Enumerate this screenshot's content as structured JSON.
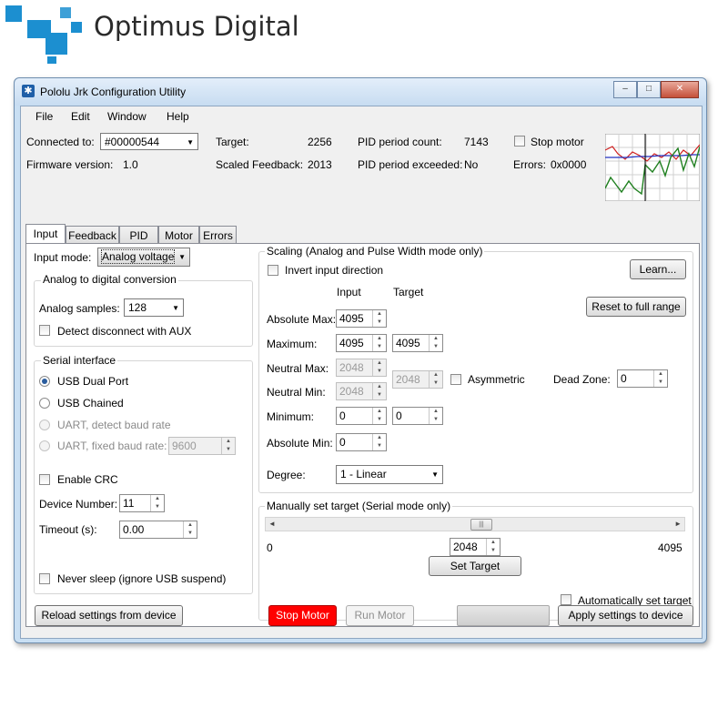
{
  "brand": {
    "name": "Optimus Digital"
  },
  "window": {
    "title": "Pololu Jrk Configuration Utility",
    "minimize": "–",
    "maximize": "□",
    "close": "✕"
  },
  "menu": [
    "File",
    "Edit",
    "Window",
    "Help"
  ],
  "status": {
    "connected_label": "Connected to:",
    "device": "#00000544",
    "firmware_label": "Firmware version:",
    "firmware": "1.0",
    "target_label": "Target:",
    "target": "2256",
    "scaled_feedback_label": "Scaled Feedback:",
    "scaled_feedback": "2013",
    "pid_count_label": "PID period count:",
    "pid_count": "7143",
    "pid_exceeded_label": "PID period exceeded:",
    "pid_exceeded": "No",
    "stop_motor_label": "Stop motor",
    "errors_label": "Errors:",
    "errors": "0x0000"
  },
  "tabs": [
    "Input",
    "Feedback",
    "PID",
    "Motor",
    "Errors"
  ],
  "input": {
    "mode_label": "Input mode:",
    "mode": "Analog voltage",
    "adc_group": "Analog to digital conversion",
    "samples_label": "Analog samples:",
    "samples": "128",
    "detect_disconnect": "Detect disconnect with AUX",
    "serial_group": "Serial interface",
    "serial_options": [
      "USB Dual Port",
      "USB Chained",
      "UART, detect baud rate",
      "UART, fixed baud rate:"
    ],
    "baud": "9600",
    "enable_crc": "Enable CRC",
    "device_number_label": "Device Number:",
    "device_number": "11",
    "timeout_label": "Timeout (s):",
    "timeout": "0.00",
    "never_sleep": "Never sleep (ignore USB suspend)"
  },
  "scaling": {
    "group": "Scaling (Analog and Pulse Width mode only)",
    "invert": "Invert input direction",
    "learn": "Learn...",
    "reset": "Reset to full range",
    "col_input": "Input",
    "col_target": "Target",
    "abs_max_label": "Absolute Max:",
    "abs_max": "4095",
    "max_label": "Maximum:",
    "max_input": "4095",
    "max_target": "4095",
    "neutral_max_label": "Neutral Max:",
    "neutral_max": "2048",
    "neutral_target": "2048",
    "neutral_min_label": "Neutral Min:",
    "neutral_min": "2048",
    "asymmetric": "Asymmetric",
    "dead_zone_label": "Dead Zone:",
    "dead_zone": "0",
    "min_label": "Minimum:",
    "min_input": "0",
    "min_target": "0",
    "abs_min_label": "Absolute Min:",
    "abs_min": "0",
    "degree_label": "Degree:",
    "degree": "1 - Linear"
  },
  "manual": {
    "group": "Manually set target (Serial mode only)",
    "min": "0",
    "max": "4095",
    "value": "2048",
    "set_target": "Set Target",
    "auto": "Automatically set target"
  },
  "bottom": {
    "reload": "Reload settings from device",
    "stop": "Stop Motor",
    "run": "Run Motor",
    "apply": "Apply settings to device"
  },
  "colors": {
    "accent": "#1c8fd0",
    "stop": "#ff0000"
  }
}
